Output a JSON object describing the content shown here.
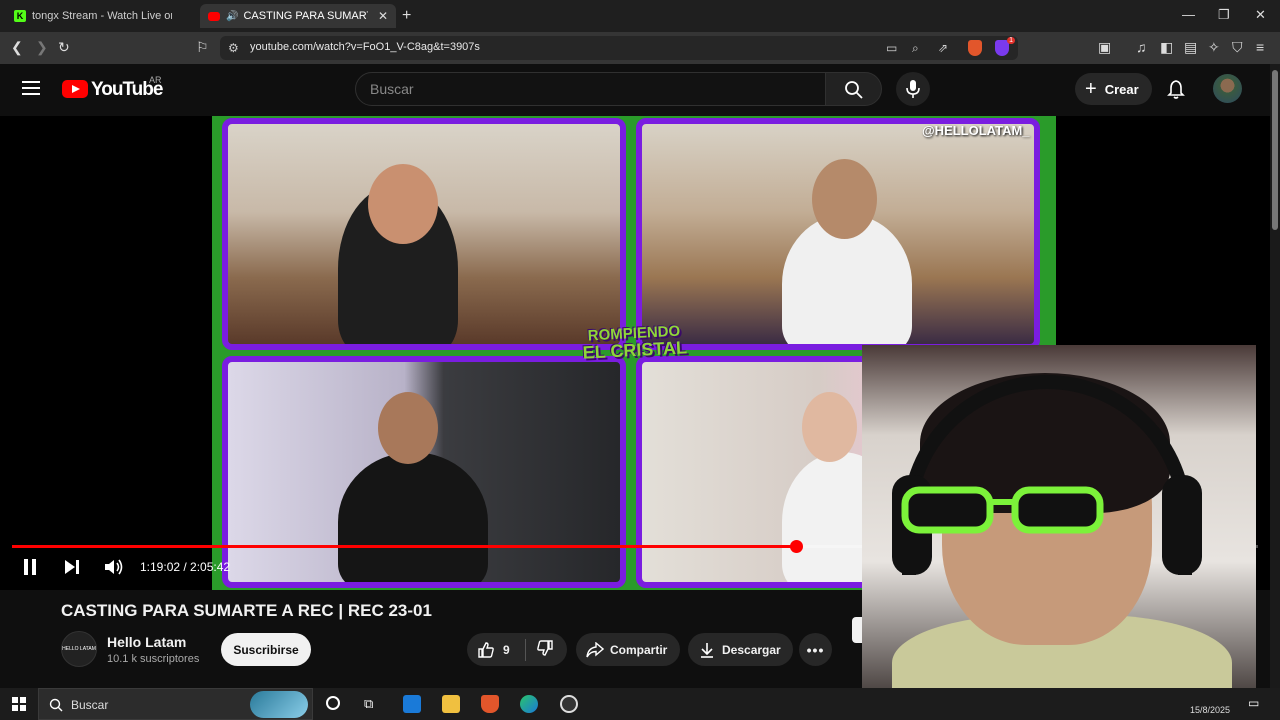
{
  "browser": {
    "tabs": [
      {
        "title": "tongx Stream - Watch Live on Kic",
        "favicon": "kick-icon"
      },
      {
        "title": "CASTING PARA SUMARTE A R",
        "favicon": "youtube-icon",
        "audio": true
      }
    ],
    "url": "youtube.com/watch?v=FoO1_V-C8ag&t=3907s",
    "brave_badge": "1"
  },
  "youtube": {
    "logo_text": "YouTube",
    "country": "AR",
    "search_placeholder": "Buscar",
    "create_label": "Crear"
  },
  "player": {
    "handle": "@HELLOLATAM_",
    "show_logo_line1": "ROMPIENDO",
    "show_logo_line2": "EL CRISTAL",
    "time": "1:19:02 / 2:05:42",
    "progress": 0.629
  },
  "video": {
    "title": "CASTING PARA SUMARTE A REC | REC 23-01",
    "channel_name": "Hello Latam",
    "channel_avatar_text": "HELLO LATAM",
    "subscribers": "10.1 k suscriptores",
    "subscribe_label": "Suscribirse",
    "likes": "9",
    "share_label": "Compartir",
    "download_label": "Descargar"
  },
  "taskbar": {
    "search_placeholder": "Buscar",
    "date": "15/8/2025"
  },
  "colors": {
    "accent": "#ff0000",
    "frame_green": "#2a9b2a",
    "frame_purple": "#7a1de0"
  }
}
